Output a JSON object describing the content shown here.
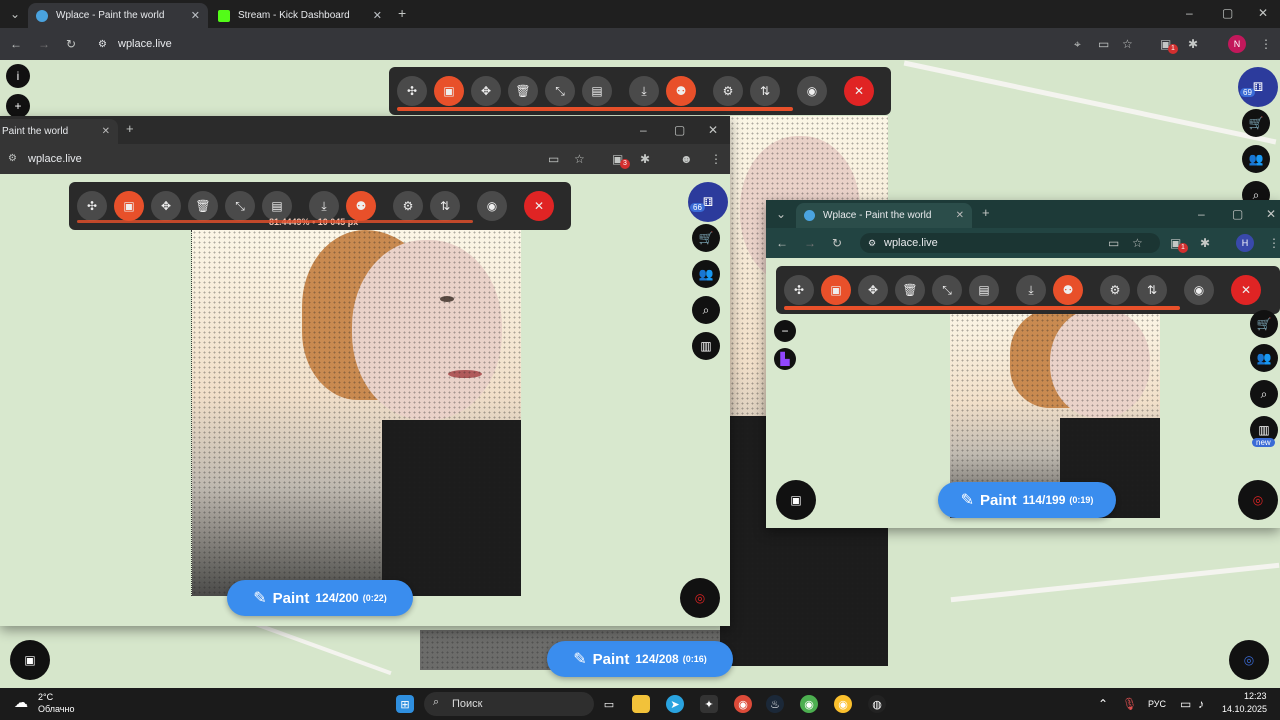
{
  "browser": {
    "tabs": [
      {
        "title": "Wplace - Paint the world",
        "active": true
      },
      {
        "title": "Stream - Kick Dashboard",
        "active": false
      }
    ],
    "url": "wplace.live",
    "profile_initial": "N",
    "ext_badge": "1"
  },
  "overlay": {
    "progress_percent": "81.4449%",
    "pixels": "10 045 px",
    "progress_fraction": 0.81
  },
  "user_badge_main": "69",
  "user_badge_win1": "66",
  "sidebar_new_badge": "new",
  "window1": {
    "tab_title": "Paint the world",
    "url": "wplace.live",
    "ext_badge": "3",
    "paint": {
      "label": "Paint",
      "count": "124/200",
      "timer": "(0:22)"
    }
  },
  "window2": {
    "tab_title": "Wplace - Paint the world",
    "url": "wplace.live",
    "ext_badge": "1",
    "profile_initial": "H",
    "paint": {
      "label": "Paint",
      "count": "114/199",
      "timer": "(0:19)"
    }
  },
  "main_paint": {
    "label": "Paint",
    "count": "124/208",
    "timer": "(0:16)"
  },
  "map_controls": {
    "info": "i",
    "zoom_in": "+",
    "zoom_out": "−"
  },
  "taskbar": {
    "weather_temp": "2°C",
    "weather_text": "Облачно",
    "search_placeholder": "Поиск",
    "language": "РУС",
    "time": "12:23",
    "date": "14.10.2025"
  },
  "colors": {
    "accent_orange": "#e8502a",
    "paint_blue": "#3a8dee",
    "close_red": "#e02424"
  }
}
